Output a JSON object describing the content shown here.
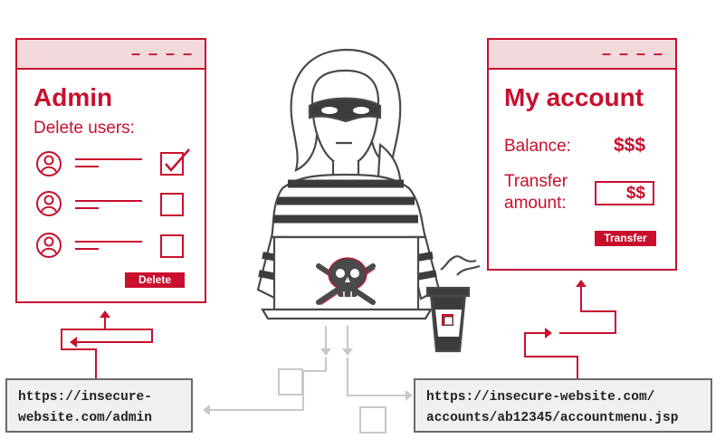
{
  "admin_window": {
    "dashes": "– – – –",
    "title": "Admin",
    "subtitle": "Delete users:",
    "delete_label": "Delete"
  },
  "account_window": {
    "dashes": "– – – –",
    "title": "My account",
    "balance_label": "Balance:",
    "balance_value": "$$$",
    "transfer_label_line1": "Transfer",
    "transfer_label_line2": "amount:",
    "transfer_value": "$$",
    "transfer_button": "Transfer"
  },
  "urls": {
    "admin_line1": "https://insecure-",
    "admin_line2": "website.com/admin",
    "account_line1": "https://insecure-website.com/",
    "account_line2": "accounts/ab12345/accountmenu.jsp"
  },
  "colors": {
    "accent": "#c8102e",
    "gray": "#6b6b6b",
    "light_gray": "#c8c8c8"
  },
  "icons": [
    "user-icon",
    "checkbox-checked-icon",
    "checkbox-empty-icon",
    "skull-crossbones-icon",
    "hacker-figure",
    "coffee-cup-icon"
  ]
}
